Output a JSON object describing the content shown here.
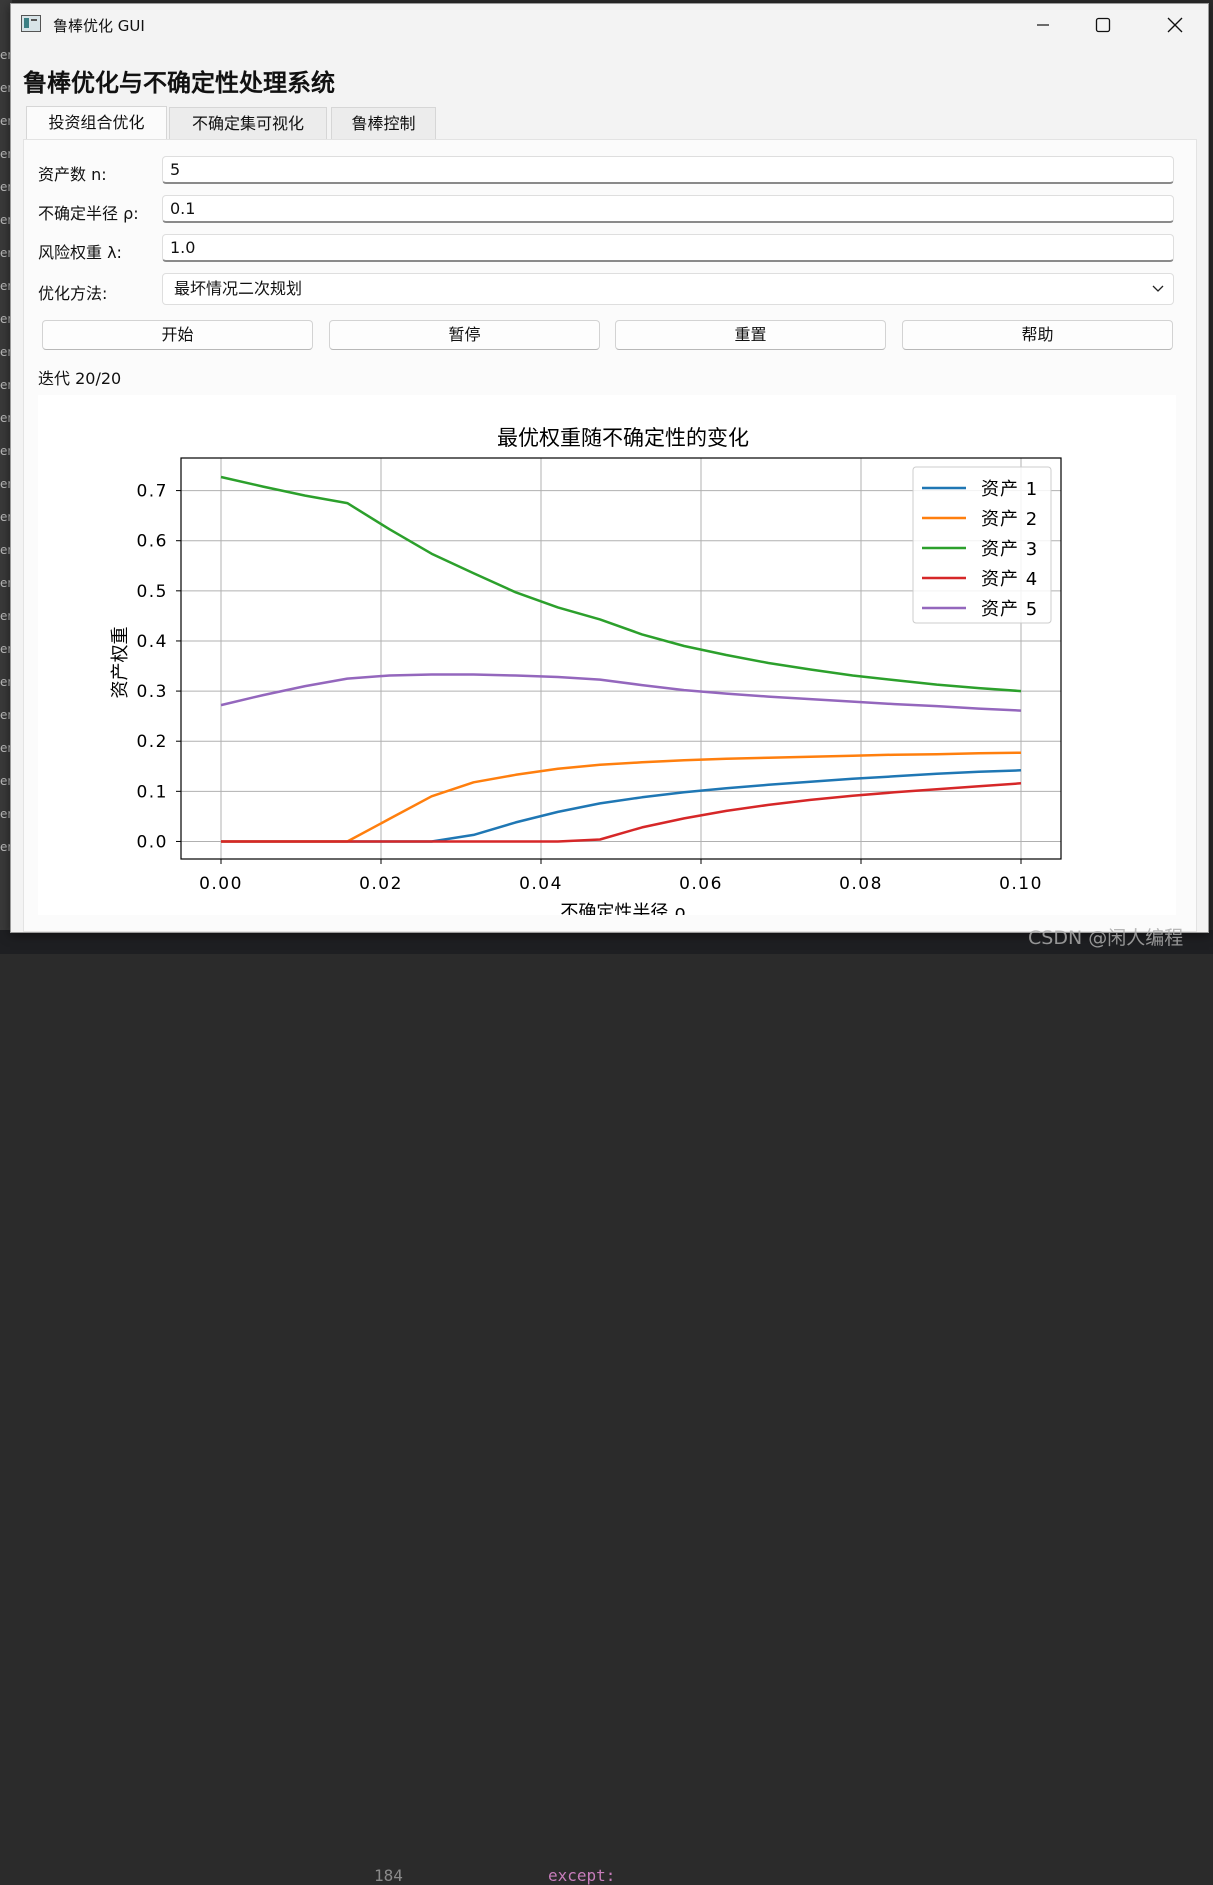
{
  "window": {
    "title": "鲁棒优化 GUI",
    "heading": "鲁棒优化与不确定性处理系统",
    "controls": [
      "minimize-icon",
      "maximize-icon",
      "close-icon"
    ]
  },
  "tabs": [
    {
      "label": "投资组合优化",
      "active": true
    },
    {
      "label": "不确定集可视化",
      "active": false
    },
    {
      "label": "鲁棒控制",
      "active": false
    }
  ],
  "form": {
    "n_label": "资产数 n:",
    "n_value": "5",
    "rho_label": "不确定半径 ρ:",
    "rho_value": "0.1",
    "lambda_label": "风险权重 λ:",
    "lambda_value": "1.0",
    "method_label": "优化方法:",
    "method_value": "最坏情况二次规划"
  },
  "buttons": {
    "start": "开始",
    "pause": "暂停",
    "reset": "重置",
    "help": "帮助"
  },
  "status": "迭代 20/20",
  "watermark": "CSDN @闲人编程",
  "background": {
    "side_text": [
      "er",
      "er",
      "er",
      "er",
      "er",
      "er",
      "er",
      "er",
      "er",
      "er",
      "er",
      "er",
      "er",
      "er",
      "er",
      "er",
      "er",
      "er",
      "er",
      "er",
      "er",
      "er",
      "er",
      "er",
      "er"
    ],
    "line_number": "184",
    "code_text": "except:"
  },
  "chart_data": {
    "type": "line",
    "title": "最优权重随不确定性的变化",
    "xlabel": "不确定性半径 ρ",
    "ylabel": "资产权重",
    "xlim": [
      -0.005,
      0.105
    ],
    "ylim": [
      -0.035,
      0.765
    ],
    "xticks": [
      0.0,
      0.02,
      0.04,
      0.06,
      0.08,
      0.1
    ],
    "xtick_labels": [
      "0.00",
      "0.02",
      "0.04",
      "0.06",
      "0.08",
      "0.10"
    ],
    "yticks": [
      0.0,
      0.1,
      0.2,
      0.3,
      0.4,
      0.5,
      0.6,
      0.7
    ],
    "ytick_labels": [
      "0.0",
      "0.1",
      "0.2",
      "0.3",
      "0.4",
      "0.5",
      "0.6",
      "0.7"
    ],
    "grid": true,
    "legend": "top-right",
    "x": [
      0.0,
      0.00526,
      0.01053,
      0.01579,
      0.02105,
      0.02632,
      0.03158,
      0.03684,
      0.04211,
      0.04737,
      0.05263,
      0.05789,
      0.06316,
      0.06842,
      0.07368,
      0.07895,
      0.08421,
      0.08947,
      0.09474,
      0.1
    ],
    "series": [
      {
        "name": "资产 1",
        "color": "#1f77b4",
        "values": [
          0,
          0,
          0,
          0,
          0,
          0,
          0.013,
          0.038,
          0.059,
          0.076,
          0.088,
          0.098,
          0.106,
          0.113,
          0.119,
          0.125,
          0.13,
          0.135,
          0.139,
          0.142
        ]
      },
      {
        "name": "资产 2",
        "color": "#ff7f0e",
        "values": [
          0,
          0,
          0,
          0,
          0.045,
          0.09,
          0.118,
          0.133,
          0.145,
          0.153,
          0.158,
          0.162,
          0.165,
          0.167,
          0.169,
          0.171,
          0.173,
          0.174,
          0.176,
          0.177
        ]
      },
      {
        "name": "资产 3",
        "color": "#2ca02c",
        "values": [
          0.727,
          0.708,
          0.69,
          0.675,
          0.623,
          0.574,
          0.535,
          0.497,
          0.467,
          0.443,
          0.413,
          0.39,
          0.372,
          0.356,
          0.343,
          0.331,
          0.322,
          0.313,
          0.306,
          0.3
        ]
      },
      {
        "name": "资产 4",
        "color": "#d62728",
        "values": [
          0,
          0,
          0,
          0,
          0,
          0,
          0,
          0,
          0,
          0.004,
          0.028,
          0.046,
          0.061,
          0.073,
          0.083,
          0.091,
          0.098,
          0.104,
          0.11,
          0.116
        ]
      },
      {
        "name": "资产 5",
        "color": "#9467bd",
        "values": [
          0.272,
          0.292,
          0.31,
          0.325,
          0.331,
          0.333,
          0.333,
          0.331,
          0.328,
          0.323,
          0.312,
          0.302,
          0.295,
          0.289,
          0.284,
          0.279,
          0.274,
          0.27,
          0.265,
          0.261
        ]
      }
    ]
  }
}
